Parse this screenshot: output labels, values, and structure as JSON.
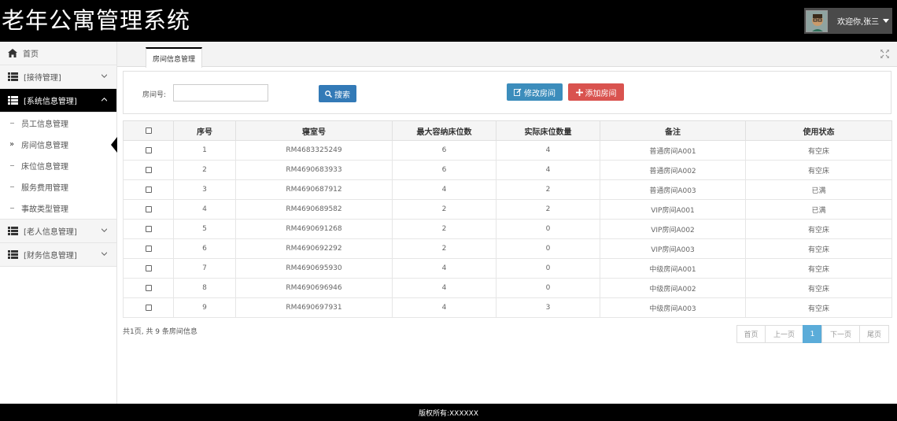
{
  "header": {
    "app_title": "老年公寓管理系统",
    "welcome": "欢迎你,张三"
  },
  "sidebar": {
    "home": "首页",
    "groups": [
      {
        "label": "[接待管理]",
        "expanded": false
      },
      {
        "label": "[系统信息管理]",
        "expanded": true
      },
      {
        "label": "[老人信息管理]",
        "expanded": false
      },
      {
        "label": "[财务信息管理]",
        "expanded": false
      }
    ],
    "sub_items": [
      "员工信息管理",
      "房间信息管理",
      "床位信息管理",
      "服务费用管理",
      "事故类型管理"
    ],
    "active_sub": "房间信息管理"
  },
  "tabs": [
    {
      "label": "房间信息管理",
      "active": true
    }
  ],
  "search": {
    "room_label": "房间号:",
    "room_value": "",
    "search_button": "搜索",
    "edit_button": "修改房间",
    "add_button": "添加房间"
  },
  "table": {
    "columns": [
      "序号",
      "寝室号",
      "最大容纳床位数",
      "实际床位数量",
      "备注",
      "使用状态"
    ],
    "rows": [
      [
        "1",
        "RM4683325249",
        "6",
        "4",
        "普通房间A001",
        "有空床"
      ],
      [
        "2",
        "RM4690683933",
        "6",
        "4",
        "普通房间A002",
        "有空床"
      ],
      [
        "3",
        "RM4690687912",
        "4",
        "2",
        "普通房间A003",
        "已满"
      ],
      [
        "4",
        "RM4690689582",
        "2",
        "2",
        "VIP房间A001",
        "已满"
      ],
      [
        "5",
        "RM4690691268",
        "2",
        "0",
        "VIP房间A002",
        "有空床"
      ],
      [
        "6",
        "RM4690692292",
        "2",
        "0",
        "VIP房间A003",
        "有空床"
      ],
      [
        "7",
        "RM4690695930",
        "4",
        "0",
        "中级房间A001",
        "有空床"
      ],
      [
        "8",
        "RM4690696946",
        "4",
        "0",
        "中级房间A002",
        "有空床"
      ],
      [
        "9",
        "RM4690697931",
        "4",
        "3",
        "中级房间A003",
        "有空床"
      ]
    ]
  },
  "summary": "共1页, 共 9 条房间信息",
  "pagination": {
    "first": "首页",
    "prev": "上一页",
    "current": "1",
    "next": "下一页",
    "last": "尾页"
  },
  "footer": "版权所有:XXXXXX",
  "colors": {
    "header_bg": "#000000",
    "search_btn": "#337ab7",
    "edit_btn": "#3c8dbc",
    "add_btn": "#d9534f",
    "page_active": "#5bacd9"
  }
}
